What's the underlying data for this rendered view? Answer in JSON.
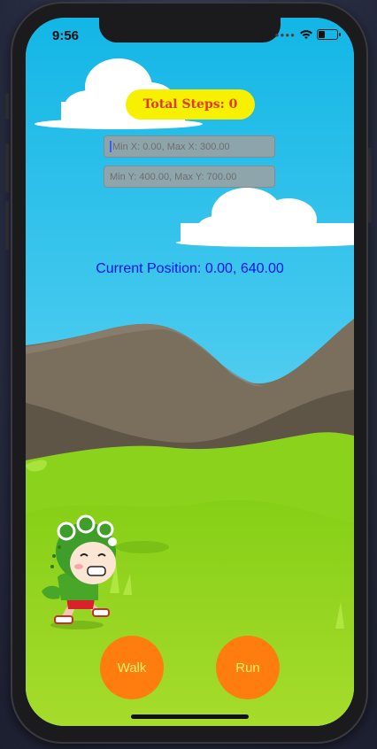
{
  "status_bar": {
    "time": "9:56"
  },
  "steps": {
    "label": "Total Steps: 0"
  },
  "inputs": {
    "x_range": {
      "placeholder": "Min X: 0.00, Max X: 300.00"
    },
    "y_range": {
      "placeholder": "Min Y: 400.00, Max Y: 700.00"
    }
  },
  "position": {
    "text": "Current Position: 0.00, 640.00"
  },
  "buttons": {
    "walk": "Walk",
    "run": "Run"
  },
  "colors": {
    "sky": "#2ec4ea",
    "badge": "#f7f000",
    "badge_text": "#e03a1e",
    "position_text": "#0a12ee",
    "button": "#ff7d0e",
    "button_text": "#fff36b"
  }
}
